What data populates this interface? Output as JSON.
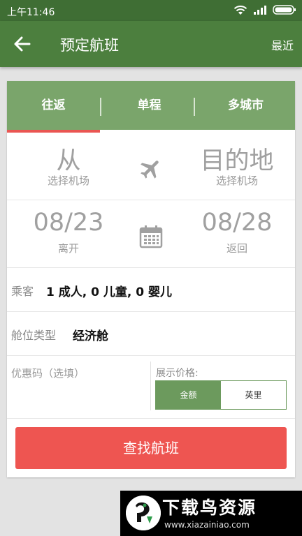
{
  "status_bar": {
    "time": "上午11:46"
  },
  "header": {
    "title": "预定航班",
    "right_action": "最近"
  },
  "trip_tabs": {
    "items": [
      "往返",
      "单程",
      "多城市"
    ],
    "selected_index": 0
  },
  "origin": {
    "value": "从",
    "hint": "选择机场"
  },
  "destination": {
    "value": "目的地",
    "hint": "选择机场"
  },
  "depart": {
    "date": "08/23",
    "label": "离开"
  },
  "return": {
    "date": "08/28",
    "label": "返回"
  },
  "passengers": {
    "label": "乘客",
    "value": "1 成人, 0 儿童, 0 婴儿"
  },
  "cabin": {
    "label": "舱位类型",
    "value": "经济舱"
  },
  "promo": {
    "placeholder": "优惠码（选填）"
  },
  "price_display": {
    "label": "展示价格:",
    "options": [
      "金额",
      "英里"
    ],
    "selected": "金额"
  },
  "search_button": {
    "label": "查找航班"
  },
  "watermark": {
    "title": "下载鸟资源",
    "url": "www.xiazainiao.com"
  },
  "colors": {
    "header": "#4c7f3e",
    "status": "#3f6e34",
    "tabs": "#7aa56b",
    "accent": "#ee5551",
    "selected_segment": "#6c9a5d"
  },
  "icons": [
    "back-arrow-icon",
    "wifi-icon",
    "signal-icon",
    "battery-icon",
    "airplane-icon",
    "calendar-icon"
  ]
}
